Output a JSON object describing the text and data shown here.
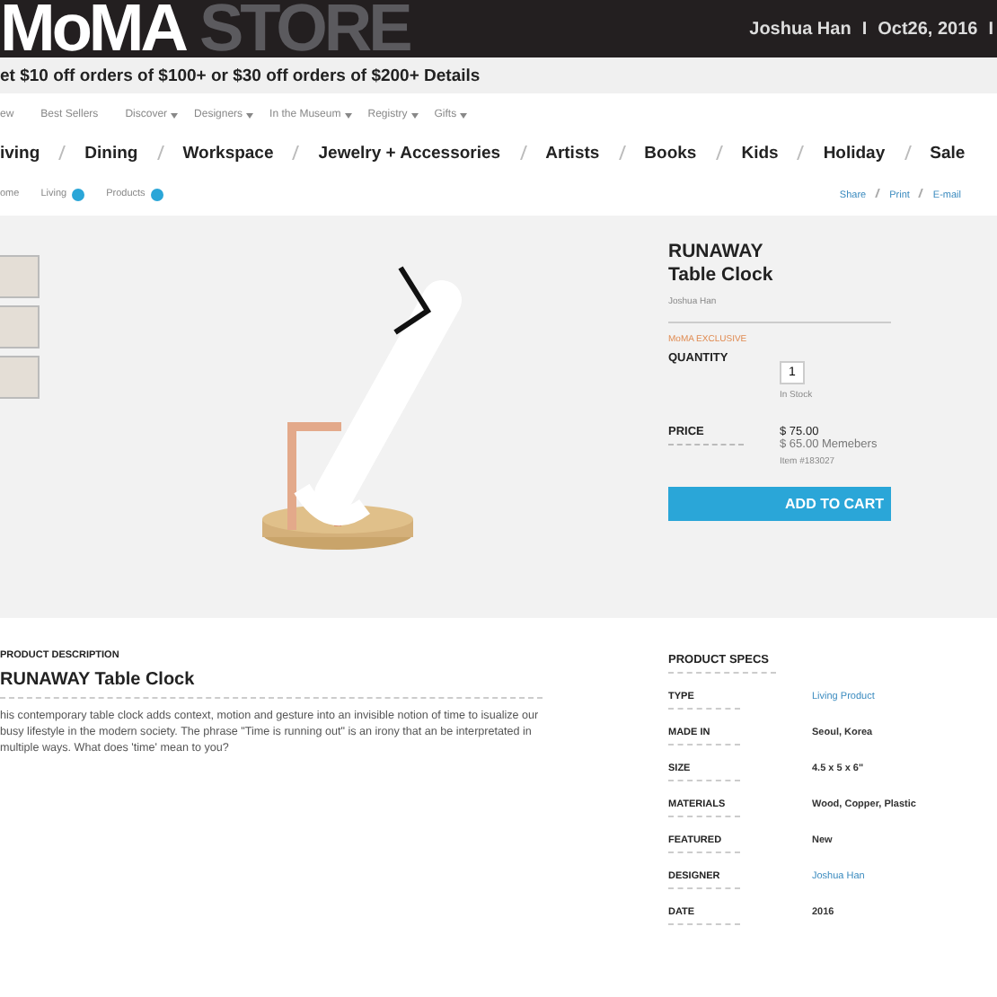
{
  "header": {
    "logo_main": "MoMA",
    "logo_sub": "STORE",
    "user": "Joshua Han",
    "separator": "I",
    "date": "Oct26, 2016",
    "separator_end": "I"
  },
  "promo": {
    "text": "et $10 off orders of $100+ or $30 off orders of $200+ Details"
  },
  "sub_nav": [
    {
      "label": "ew",
      "dropdown": false
    },
    {
      "label": "Best Sellers",
      "dropdown": false
    },
    {
      "label": "Discover",
      "dropdown": true
    },
    {
      "label": "Designers",
      "dropdown": true
    },
    {
      "label": "In the Museum",
      "dropdown": true
    },
    {
      "label": "Registry",
      "dropdown": true
    },
    {
      "label": "Gifts",
      "dropdown": true
    }
  ],
  "main_nav": [
    "iving",
    "Dining",
    "Workspace",
    "Jewelry + Accessories",
    "Artists",
    "Books",
    "Kids",
    "Holiday",
    "Sale"
  ],
  "breadcrumb": [
    {
      "label": "ome",
      "expandable": false
    },
    {
      "label": "Living",
      "expandable": true
    },
    {
      "label": "Products",
      "expandable": true
    }
  ],
  "share_links": [
    "Share",
    "Print",
    "E-mail"
  ],
  "product": {
    "title_line1": "RUNAWAY",
    "title_line2": "Table Clock",
    "designer": "Joshua Han",
    "badge": "MoMA EXCLUSIVE",
    "quantity_label": "QUANTITY",
    "quantity": "1",
    "stock": "In Stock",
    "price_label": "PRICE",
    "price": "$ 75.00",
    "member_price": "$ 65.00 Memebers",
    "item_no": "Item #183027",
    "add_button": "ADD TO CART"
  },
  "description": {
    "heading": "PRODUCT DESCRIPTION",
    "title": "RUNAWAY Table Clock",
    "body": "his contemporary table clock adds context, motion and gesture into an invisible notion of time to isualize our busy lifestyle in the modern society. The phrase \"Time is running out\" is an irony that an be interpretated in multiple ways. What does 'time' mean to you?"
  },
  "specs": {
    "heading": "PRODUCT SPECS",
    "rows": [
      {
        "label": "TYPE",
        "value": "Living Product",
        "kind": "link"
      },
      {
        "label": "MADE IN",
        "value": "Seoul, Korea",
        "kind": "text"
      },
      {
        "label": "SIZE",
        "value": "4.5 x 5 x 6\"",
        "kind": "text"
      },
      {
        "label": "MATERIALS",
        "value": "Wood, Copper, Plastic",
        "kind": "text"
      },
      {
        "label": "FEATURED",
        "value": "New",
        "kind": "text"
      },
      {
        "label": "DESIGNER",
        "value": "Joshua Han",
        "kind": "link"
      },
      {
        "label": "DATE",
        "value": "2016",
        "kind": "text"
      }
    ]
  }
}
